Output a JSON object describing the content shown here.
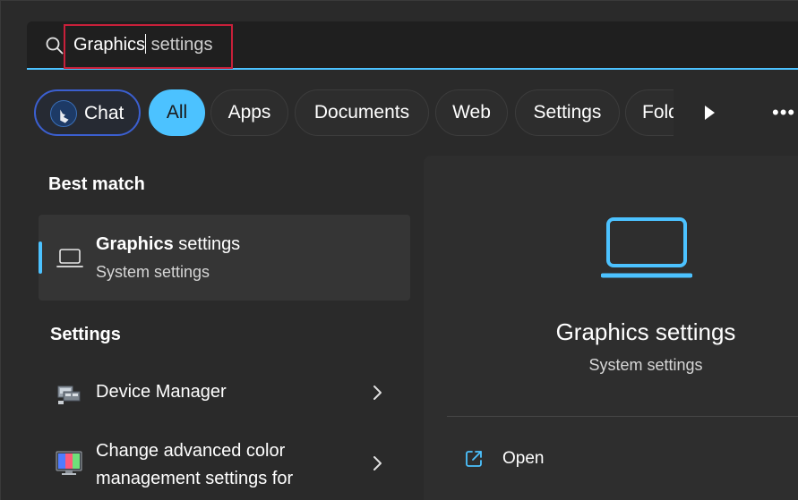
{
  "search": {
    "typed_text": "Graphics",
    "suggestion_text": " settings"
  },
  "filters": {
    "chips": [
      {
        "label": "Chat",
        "icon": "bing-icon"
      },
      {
        "label": "All",
        "active": true
      },
      {
        "label": "Apps"
      },
      {
        "label": "Documents"
      },
      {
        "label": "Web"
      },
      {
        "label": "Settings"
      },
      {
        "label": "Folders"
      }
    ],
    "play_icon": "play-icon",
    "more_icon": "more-icon"
  },
  "results": {
    "best_match_heading": "Best match",
    "best_match": {
      "title_bold": "Graphics",
      "title_rest": " settings",
      "subtitle": "System settings",
      "icon": "laptop-icon"
    },
    "settings_heading": "Settings",
    "settings_items": [
      {
        "label": "Device Manager",
        "icon": "device-manager-icon"
      },
      {
        "label_line1": "Change advanced color",
        "label_line2": "management settings for",
        "icon": "color-management-icon"
      }
    ]
  },
  "detail": {
    "title": "Graphics settings",
    "subtitle": "System settings",
    "action_open": "Open",
    "icon": "laptop-icon"
  },
  "colors": {
    "accent": "#4cc2ff",
    "highlight_box": "#c8203a",
    "chat_border": "#3b5fd0"
  }
}
